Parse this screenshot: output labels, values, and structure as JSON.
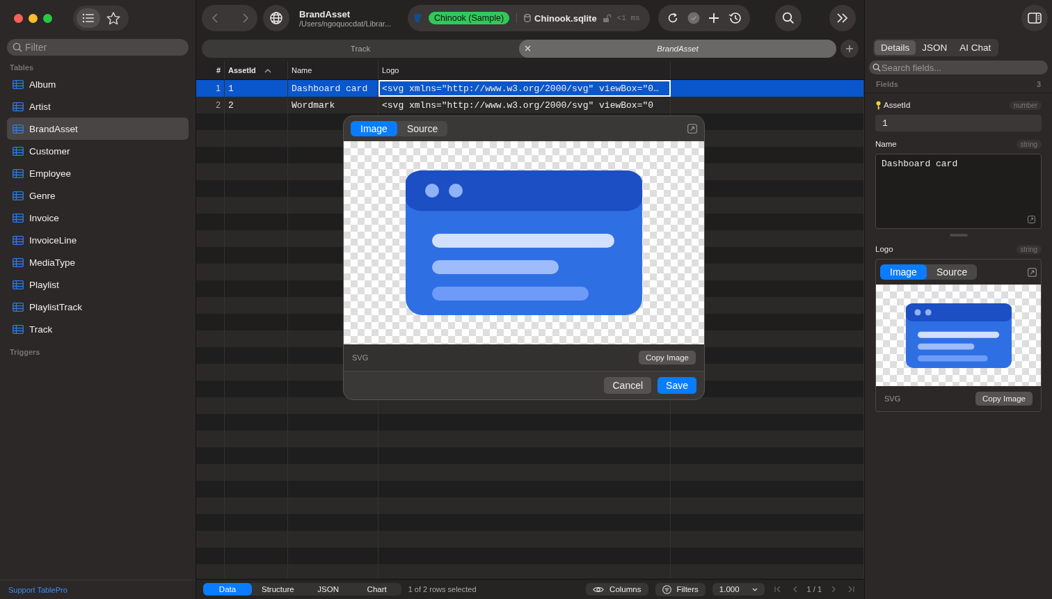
{
  "sidebar": {
    "modes": [
      {
        "kind": "list",
        "selected": true
      },
      {
        "kind": "favorites",
        "selected": false
      }
    ],
    "filter": {
      "placeholder": "Filter"
    },
    "sections": [
      {
        "title": "Tables",
        "items": [
          {
            "label": "Album",
            "selected": false
          },
          {
            "label": "Artist",
            "selected": false
          },
          {
            "label": "BrandAsset",
            "selected": true
          },
          {
            "label": "Customer",
            "selected": false
          },
          {
            "label": "Employee",
            "selected": false
          },
          {
            "label": "Genre",
            "selected": false
          },
          {
            "label": "Invoice",
            "selected": false
          },
          {
            "label": "InvoiceLine",
            "selected": false
          },
          {
            "label": "MediaType",
            "selected": false
          },
          {
            "label": "Playlist",
            "selected": false
          },
          {
            "label": "PlaylistTrack",
            "selected": false
          },
          {
            "label": "Track",
            "selected": false
          }
        ]
      },
      {
        "title": "Triggers"
      }
    ],
    "footer_link": "Support TablePro"
  },
  "toolbar": {
    "title": "BrandAsset",
    "path": "/Users/ngoquocdat/Librar...",
    "connection": "Chinook (Sample)",
    "database": "Chinook.sqlite",
    "timing": "<1 ms"
  },
  "tabs": [
    {
      "label": "Track",
      "selected": false,
      "preview": false
    },
    {
      "label": "BrandAsset",
      "selected": true,
      "preview": true
    }
  ],
  "table": {
    "columns": [
      {
        "label": "#",
        "sorted": false
      },
      {
        "label": "AssetId",
        "sorted": true
      },
      {
        "label": "Name",
        "sorted": false
      },
      {
        "label": "Logo",
        "sorted": false
      }
    ],
    "rows": [
      {
        "selected": true,
        "cells": [
          "1",
          "1",
          "Dashboard card",
          "<svg xmlns=\"http://www.w3.org/2000/svg\" viewBox=\"0…"
        ]
      },
      {
        "selected": false,
        "cells": [
          "2",
          "2",
          "Wordmark",
          "<svg xmlns=\"http://www.w3.org/2000/svg\" viewBox=\"0"
        ]
      }
    ]
  },
  "popover": {
    "tabs": [
      {
        "label": "Image",
        "selected": true
      },
      {
        "label": "Source",
        "selected": false
      }
    ],
    "format": "SVG",
    "copy_button": "Copy Image",
    "buttons": [
      {
        "label": "Cancel",
        "kind": "secondary"
      },
      {
        "label": "Save",
        "kind": "primary"
      }
    ]
  },
  "details": {
    "tabs": [
      {
        "label": "Details",
        "selected": true
      },
      {
        "label": "JSON",
        "selected": false
      },
      {
        "label": "AI Chat",
        "selected": false
      }
    ],
    "search": {
      "placeholder": "Search fields..."
    },
    "fields_label": "Fields",
    "fields_count": "3",
    "fields": [
      {
        "name": "AssetId",
        "type": "number",
        "kind": "input",
        "primary_key": true,
        "value": "1"
      },
      {
        "name": "Name",
        "type": "string",
        "kind": "textarea",
        "primary_key": false,
        "value": "Dashboard card"
      },
      {
        "name": "Logo",
        "type": "string",
        "kind": "image",
        "primary_key": false,
        "tabs": [
          {
            "label": "Image",
            "selected": true
          },
          {
            "label": "Source",
            "selected": false
          }
        ],
        "format": "SVG",
        "copy_button": "Copy Image"
      }
    ]
  },
  "status_bar": {
    "views": [
      {
        "label": "Data",
        "selected": true
      },
      {
        "label": "Structure",
        "selected": false
      },
      {
        "label": "JSON",
        "selected": false
      },
      {
        "label": "Chart",
        "selected": false
      }
    ],
    "selection": "1 of 2 rows selected",
    "columns_button": "Columns",
    "filters_button": "Filters",
    "limit": "1.000",
    "page": "1 / 1"
  }
}
